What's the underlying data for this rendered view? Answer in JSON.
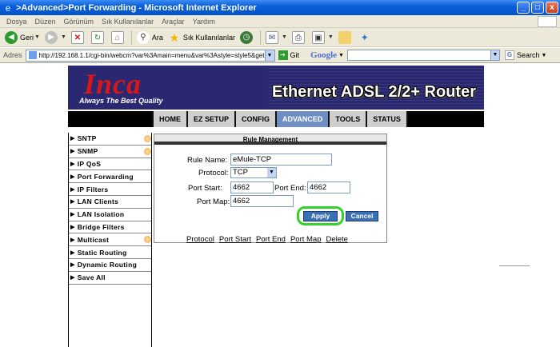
{
  "window": {
    "title": ">Advanced>Port Forwarding - Microsoft Internet Explorer",
    "minimize": "_",
    "maximize": "□",
    "close": "x"
  },
  "menubar": [
    "Dosya",
    "Düzen",
    "Görünüm",
    "Sık Kullanılanlar",
    "Araçlar",
    "Yardım"
  ],
  "toolbar": {
    "back": "Geri",
    "search": "Ara",
    "favorites": "Sık Kullanılanlar"
  },
  "address": {
    "label": "Adres",
    "url": "http://192.168.1.1/cgi-bin/webcm?var%3Amain=menu&var%3Astyle=style5&getpag",
    "go": "Git",
    "google_label": "Google",
    "google_search": "Search"
  },
  "banner": {
    "logo": "Inca",
    "slogan": "Always The Best Quality",
    "product": "Ethernet ADSL 2/2+ Router"
  },
  "nav": {
    "tabs": [
      "HOME",
      "EZ SETUP",
      "CONFIG",
      "ADVANCED",
      "TOOLS",
      "STATUS"
    ],
    "active": "ADVANCED"
  },
  "sidebar": {
    "items": [
      {
        "label": "SNTP"
      },
      {
        "label": "SNMP"
      },
      {
        "label": "IP QoS"
      },
      {
        "label": "Port Forwarding"
      },
      {
        "label": "IP Filters"
      },
      {
        "label": "LAN Clients"
      },
      {
        "label": "LAN Isolation"
      },
      {
        "label": "Bridge Filters"
      },
      {
        "label": "Multicast"
      },
      {
        "label": "Static Routing"
      },
      {
        "label": "Dynamic Routing"
      },
      {
        "label": "Save All"
      }
    ]
  },
  "rule": {
    "title": "Rule Management",
    "rule_name_label": "Rule Name:",
    "rule_name": "eMule-TCP",
    "protocol_label": "Protocol:",
    "protocol": "TCP",
    "port_start_label": "Port Start:",
    "port_start": "4662",
    "port_end_label": "Port End:",
    "port_end": "4662",
    "port_map_label": "Port Map:",
    "port_map": "4662",
    "apply": "Apply",
    "cancel": "Cancel"
  },
  "table_headers": [
    "Protocol",
    "Port Start",
    "Port End",
    "Port Map",
    "Delete"
  ],
  "colors": {
    "banner_bg": "#2a2870",
    "logo": "#d81818",
    "active_tab": "#6f8fc4",
    "button": "#3a6fb4",
    "highlight": "#33d12a"
  }
}
